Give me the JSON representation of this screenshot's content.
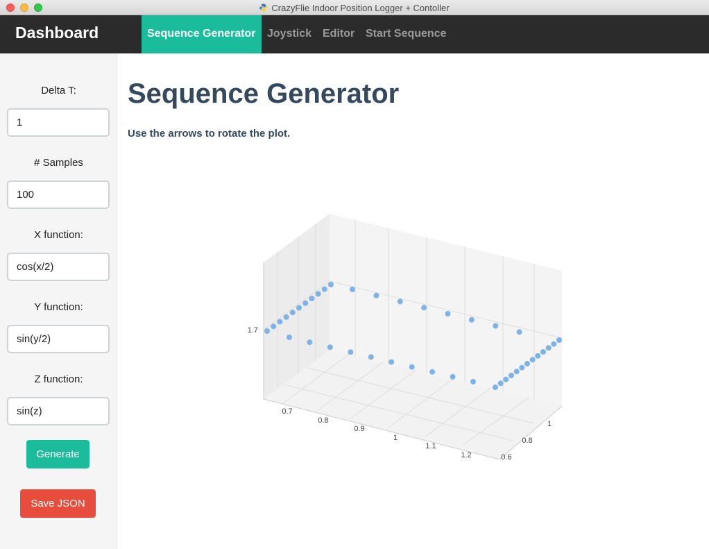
{
  "window": {
    "title": "CrazyFlie Indoor Position Logger + Contoller"
  },
  "navbar": {
    "brand": "Dashboard",
    "items": [
      {
        "label": "Sequence Generator",
        "active": true
      },
      {
        "label": "Joystick",
        "active": false
      },
      {
        "label": "Editor",
        "active": false
      },
      {
        "label": "Start Sequence",
        "active": false
      }
    ]
  },
  "sidebar": {
    "fields": [
      {
        "label": "Delta T:",
        "value": "1"
      },
      {
        "label": "# Samples",
        "value": "100"
      },
      {
        "label": "X function:",
        "value": "cos(x/2)"
      },
      {
        "label": "Y function:",
        "value": "sin(y/2)"
      },
      {
        "label": "Z function:",
        "value": "sin(z)"
      }
    ],
    "generate_label": "Generate",
    "save_label": "Save JSON"
  },
  "main": {
    "title": "Sequence Generator",
    "description": "Use the arrows to rotate the plot."
  },
  "colors": {
    "accent": "#1abc9c",
    "danger": "#e74c3c",
    "navbar": "#2b2b2b",
    "heading": "#34495e",
    "marker": "#7fb2e5"
  },
  "chart_data": {
    "type": "scatter",
    "mode": "3d",
    "x_ticks": [
      "0.7",
      "0.8",
      "0.9",
      "1",
      "1.1",
      "1.2"
    ],
    "y_ticks": [
      "0.6",
      "0.8",
      "1"
    ],
    "z_ticks": [
      "1.7"
    ],
    "xlim": [
      0.65,
      1.25
    ],
    "ylim": [
      0.55,
      1.05
    ],
    "points": [
      {
        "x": 0.65,
        "y": 1.0,
        "z": 1.7
      },
      {
        "x": 0.66,
        "y": 1.0,
        "z": 1.7
      },
      {
        "x": 0.68,
        "y": 1.0,
        "z": 1.7
      },
      {
        "x": 0.69,
        "y": 1.0,
        "z": 1.7
      },
      {
        "x": 0.71,
        "y": 1.0,
        "z": 1.7
      },
      {
        "x": 0.73,
        "y": 1.0,
        "z": 1.7
      },
      {
        "x": 0.75,
        "y": 1.0,
        "z": 1.7
      },
      {
        "x": 0.77,
        "y": 1.0,
        "z": 1.7
      },
      {
        "x": 0.79,
        "y": 1.0,
        "z": 1.7
      },
      {
        "x": 0.81,
        "y": 1.0,
        "z": 1.7
      },
      {
        "x": 0.83,
        "y": 1.0,
        "z": 1.7
      },
      {
        "x": 0.85,
        "y": 1.0,
        "z": 1.7
      },
      {
        "x": 0.9,
        "y": 1.0,
        "z": 1.7
      },
      {
        "x": 0.95,
        "y": 1.0,
        "z": 1.7
      },
      {
        "x": 1.0,
        "y": 1.0,
        "z": 1.7
      },
      {
        "x": 1.05,
        "y": 1.0,
        "z": 1.7
      },
      {
        "x": 1.1,
        "y": 1.0,
        "z": 1.7
      },
      {
        "x": 1.15,
        "y": 1.0,
        "z": 1.7
      },
      {
        "x": 1.2,
        "y": 1.0,
        "z": 1.7
      },
      {
        "x": 1.25,
        "y": 0.98,
        "z": 1.7
      },
      {
        "x": 1.25,
        "y": 0.95,
        "z": 1.7
      },
      {
        "x": 1.25,
        "y": 0.92,
        "z": 1.7
      },
      {
        "x": 1.25,
        "y": 0.89,
        "z": 1.7
      },
      {
        "x": 1.25,
        "y": 0.86,
        "z": 1.7
      },
      {
        "x": 1.25,
        "y": 0.83,
        "z": 1.7
      },
      {
        "x": 1.25,
        "y": 0.8,
        "z": 1.7
      },
      {
        "x": 1.25,
        "y": 0.77,
        "z": 1.7
      },
      {
        "x": 1.25,
        "y": 0.74,
        "z": 1.7
      },
      {
        "x": 1.25,
        "y": 0.7,
        "z": 1.7
      },
      {
        "x": 1.25,
        "y": 0.66,
        "z": 1.7
      },
      {
        "x": 1.25,
        "y": 0.62,
        "z": 1.7
      },
      {
        "x": 1.25,
        "y": 0.6,
        "z": 1.7
      },
      {
        "x": 1.2,
        "y": 0.6,
        "z": 1.7
      },
      {
        "x": 1.15,
        "y": 0.6,
        "z": 1.7
      },
      {
        "x": 1.1,
        "y": 0.6,
        "z": 1.7
      },
      {
        "x": 1.05,
        "y": 0.6,
        "z": 1.7
      },
      {
        "x": 1.0,
        "y": 0.6,
        "z": 1.7
      },
      {
        "x": 0.95,
        "y": 0.6,
        "z": 1.7
      },
      {
        "x": 0.9,
        "y": 0.6,
        "z": 1.7
      },
      {
        "x": 0.85,
        "y": 0.6,
        "z": 1.7
      },
      {
        "x": 0.8,
        "y": 0.6,
        "z": 1.7
      },
      {
        "x": 0.75,
        "y": 0.6,
        "z": 1.7
      }
    ]
  }
}
